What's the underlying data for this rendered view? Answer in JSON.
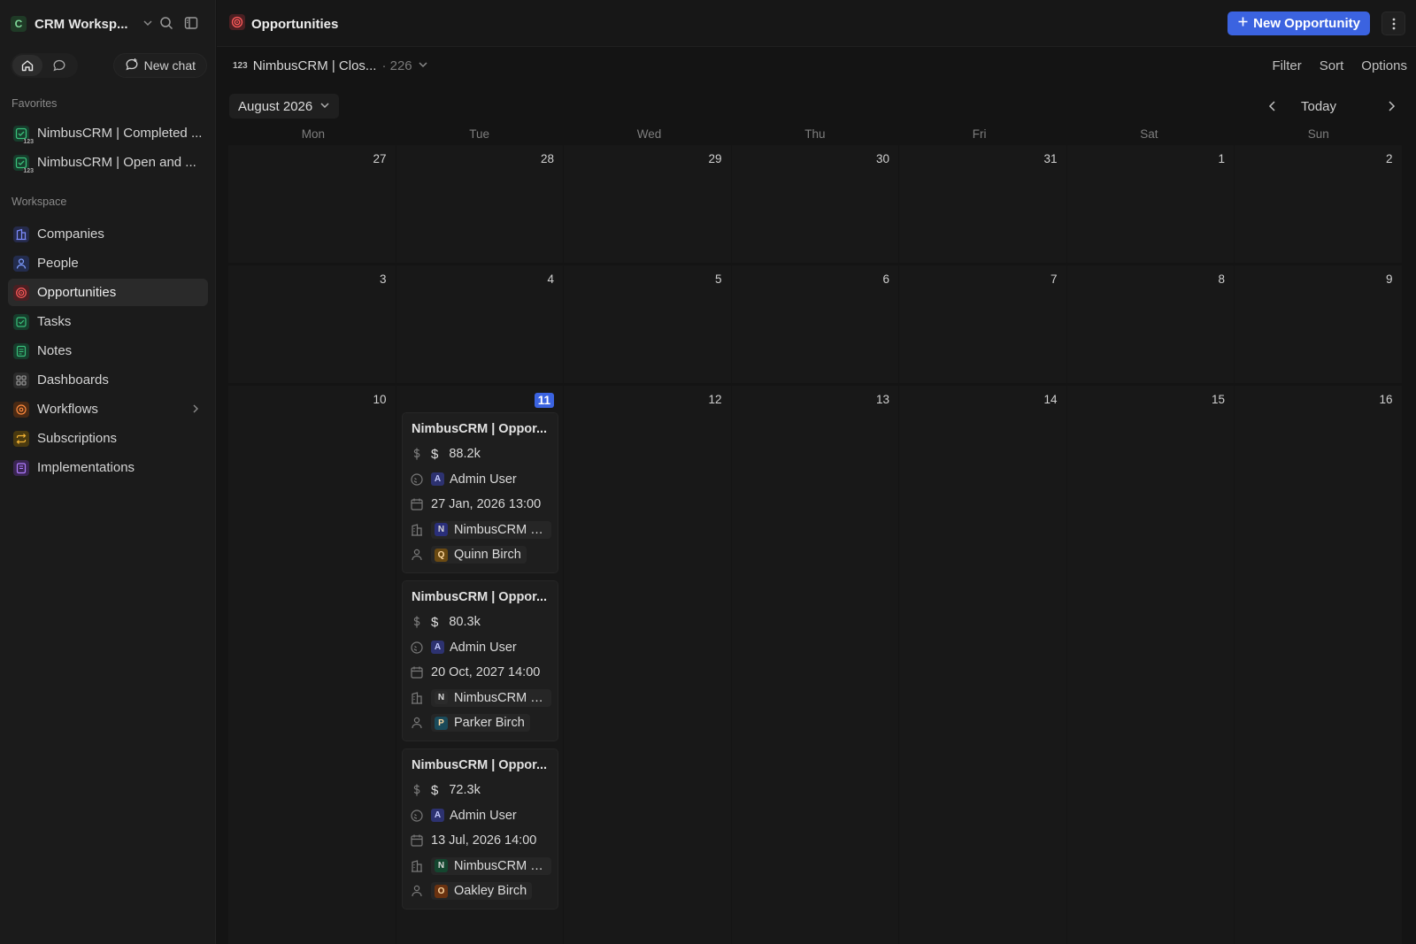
{
  "workspace": {
    "name": "CRM Worksp...",
    "logo_letter": "C"
  },
  "sidebar": {
    "new_chat_label": "New chat",
    "favorites_label": "Favorites",
    "favorites": [
      {
        "label": "NimbusCRM | Completed ..."
      },
      {
        "label": "NimbusCRM | Open and ..."
      }
    ],
    "workspace_label": "Workspace",
    "items": [
      {
        "label": "Companies",
        "icon": "building-icon",
        "color": "#6b7cff"
      },
      {
        "label": "People",
        "icon": "person-icon",
        "color": "#6b8cff"
      },
      {
        "label": "Opportunities",
        "icon": "target-icon",
        "color": "#ff5a5a"
      },
      {
        "label": "Tasks",
        "icon": "checkbox-icon",
        "color": "#39c07a"
      },
      {
        "label": "Notes",
        "icon": "note-icon",
        "color": "#39c07a"
      },
      {
        "label": "Dashboards",
        "icon": "dashboard-icon",
        "color": "#9a9a9a"
      },
      {
        "label": "Workflows",
        "icon": "workflow-icon",
        "color": "#ff8a3d"
      },
      {
        "label": "Subscriptions",
        "icon": "repeat-icon",
        "color": "#f2b233"
      },
      {
        "label": "Implementations",
        "icon": "clipboard-icon",
        "color": "#b07cff"
      }
    ]
  },
  "header": {
    "title": "Opportunities",
    "new_button_label": "New Opportunity"
  },
  "view": {
    "name": "NimbusCRM | Clos...",
    "count": "· 226",
    "filter_label": "Filter",
    "sort_label": "Sort",
    "options_label": "Options"
  },
  "calendar": {
    "month_label": "August 2026",
    "today_label": "Today",
    "weekdays": [
      "Mon",
      "Tue",
      "Wed",
      "Thu",
      "Fri",
      "Sat",
      "Sun"
    ],
    "weeks": [
      [
        "27",
        "28",
        "29",
        "30",
        "31",
        "1",
        "2"
      ],
      [
        "3",
        "4",
        "5",
        "6",
        "7",
        "8",
        "9"
      ],
      [
        "10",
        "11",
        "12",
        "13",
        "14",
        "15",
        "16"
      ]
    ],
    "today_day": "11",
    "cards": [
      {
        "title": "NimbusCRM | Oppor...",
        "amount": "88.2k",
        "owner_initial": "A",
        "owner": "Admin User",
        "date": "27 Jan, 2026 13:00",
        "company_initial": "N",
        "company": "NimbusCRM | ...",
        "company_color": "#2a2f7a",
        "contact_initial": "Q",
        "contact": "Quinn Birch",
        "contact_color": "#6b4a12"
      },
      {
        "title": "NimbusCRM | Oppor...",
        "amount": "80.3k",
        "owner_initial": "A",
        "owner": "Admin User",
        "date": "20 Oct, 2027 14:00",
        "company_initial": "N",
        "company": "NimbusCRM | ...",
        "company_color": "#2b2b2b",
        "contact_initial": "P",
        "contact": "Parker Birch",
        "contact_color": "#1a4a5a"
      },
      {
        "title": "NimbusCRM | Oppor...",
        "amount": "72.3k",
        "owner_initial": "A",
        "owner": "Admin User",
        "date": "13 Jul, 2026 14:00",
        "company_initial": "N",
        "company": "NimbusCRM | ...",
        "company_color": "#14462f",
        "contact_initial": "O",
        "contact": "Oakley Birch",
        "contact_color": "#6a3210"
      }
    ]
  }
}
